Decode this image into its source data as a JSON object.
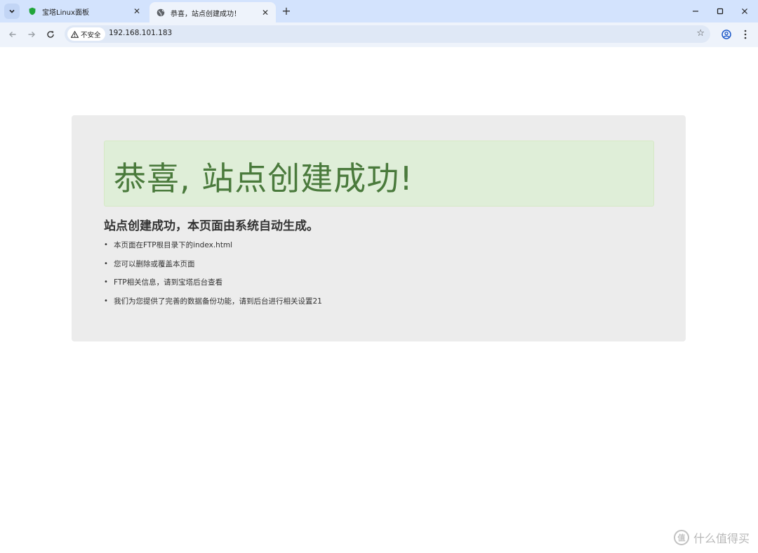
{
  "browser": {
    "tabs": [
      {
        "title": "宝塔Linux面板",
        "active": false
      },
      {
        "title": "恭喜，站点创建成功！",
        "active": true
      }
    ],
    "security_label": "不安全",
    "url": "192.168.101.183",
    "new_tab_glyph": "+",
    "close_glyph": "✕"
  },
  "page": {
    "heading": "恭喜, 站点创建成功!",
    "lead": "站点创建成功，本页面由系统自动生成。",
    "notes": [
      "本页面在FTP根目录下的index.html",
      "您可以删除或覆盖本页面",
      "FTP相关信息，请到宝塔后台查看",
      "我们为您提供了完善的数据备份功能，请到后台进行相关设置21"
    ]
  },
  "watermark": {
    "logo_text": "值",
    "text": "什么值得买"
  },
  "colors": {
    "heading": "#4a7a3c",
    "alert_bg": "#dfeed8",
    "panel_bg": "#ececec",
    "chrome_bg": "#d3e3fd"
  }
}
